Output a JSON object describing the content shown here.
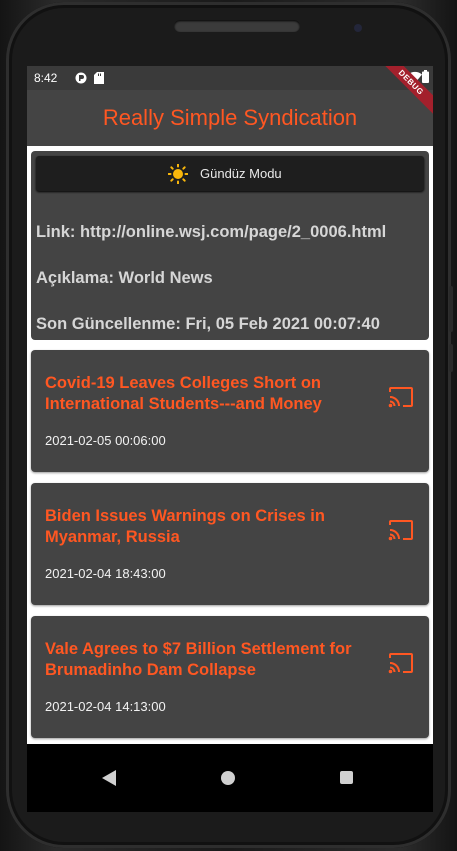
{
  "status_bar": {
    "time": "8:42",
    "icons": [
      "sync-icon",
      "sd-card-icon",
      "wifi-icon",
      "battery-icon"
    ]
  },
  "app_bar": {
    "title": "Really Simple Syndication",
    "debug_banner": "DEBUG"
  },
  "feed_info": {
    "theme_toggle_label": "Gündüz Modu",
    "theme_icon": "sun-icon",
    "link": "Link: http://online.wsj.com/page/2_0006.html",
    "description": "Açıklama: World News",
    "last_updated": "Son Güncellenme: Fri, 05 Feb 2021 00:07:40"
  },
  "articles": [
    {
      "title": "Covid-19 Leaves Colleges Short on International Students---and Money",
      "date": "2021-02-05 00:06:00"
    },
    {
      "title": "Biden Issues Warnings on Crises in Myanmar, Russia",
      "date": "2021-02-04 18:43:00"
    },
    {
      "title": "Vale Agrees to $7 Billion Settlement for Brumadinho Dam Collapse",
      "date": "2021-02-04 14:13:00"
    }
  ],
  "colors": {
    "accent": "#ff5722",
    "card_background": "#444444",
    "app_bar": "#444444",
    "sun": "#f9b70b"
  }
}
